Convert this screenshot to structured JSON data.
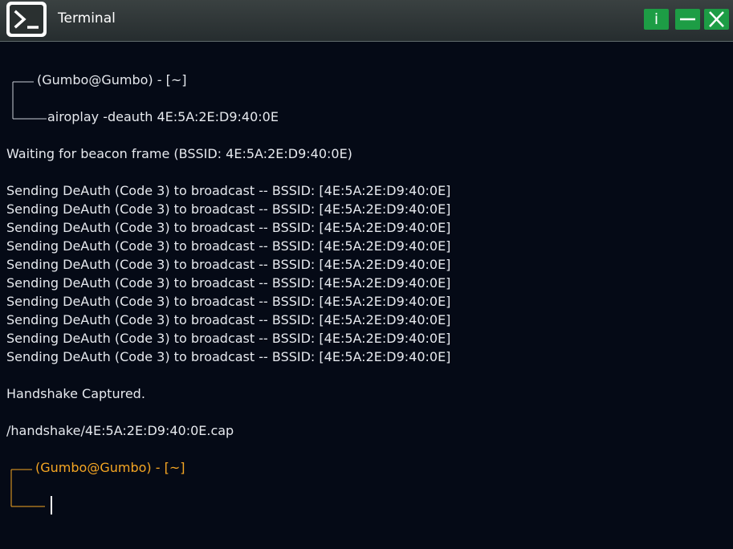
{
  "window": {
    "title": "Terminal",
    "buttons": {
      "info_label": "i",
      "minimize_icon": "minimize-icon",
      "close_icon": "close-icon"
    },
    "app_icon": "terminal-icon",
    "colors": {
      "titlebar": "#2f3636",
      "button": "#1d9d45",
      "background": "#050a16",
      "text": "#e6e9ee",
      "active_prompt": "#f5a623"
    }
  },
  "terminal": {
    "prompt1": {
      "host": "(Gumbo@Gumbo) - [~]",
      "command": "airoplay -deauth 4E:5A:2E:D9:40:0E"
    },
    "waiting": "Waiting for beacon frame (BSSID: 4E:5A:2E:D9:40:0E)",
    "deauth_lines": [
      "Sending DeAuth (Code 3) to broadcast -- BSSID: [4E:5A:2E:D9:40:0E]",
      "Sending DeAuth (Code 3) to broadcast -- BSSID: [4E:5A:2E:D9:40:0E]",
      "Sending DeAuth (Code 3) to broadcast -- BSSID: [4E:5A:2E:D9:40:0E]",
      "Sending DeAuth (Code 3) to broadcast -- BSSID: [4E:5A:2E:D9:40:0E]",
      "Sending DeAuth (Code 3) to broadcast -- BSSID: [4E:5A:2E:D9:40:0E]",
      "Sending DeAuth (Code 3) to broadcast -- BSSID: [4E:5A:2E:D9:40:0E]",
      "Sending DeAuth (Code 3) to broadcast -- BSSID: [4E:5A:2E:D9:40:0E]",
      "Sending DeAuth (Code 3) to broadcast -- BSSID: [4E:5A:2E:D9:40:0E]",
      "Sending DeAuth (Code 3) to broadcast -- BSSID: [4E:5A:2E:D9:40:0E]",
      "Sending DeAuth (Code 3) to broadcast -- BSSID: [4E:5A:2E:D9:40:0E]"
    ],
    "captured": "Handshake Captured.",
    "file_path": "/handshake/4E:5A:2E:D9:40:0E.cap",
    "prompt2": {
      "host": "(Gumbo@Gumbo) - [~]",
      "command": ""
    }
  }
}
